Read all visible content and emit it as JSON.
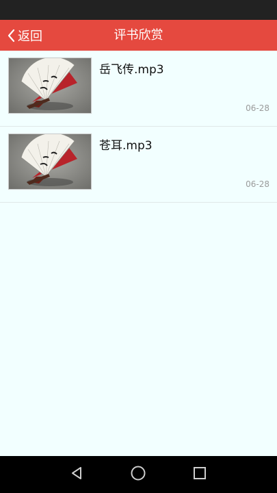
{
  "header": {
    "back_label": "返回",
    "title": "评书欣赏"
  },
  "items": [
    {
      "title": "岳飞传.mp3",
      "date": "06-28",
      "thumbnail": "folding-fan-image"
    },
    {
      "title": "苍耳.mp3",
      "date": "06-28",
      "thumbnail": "folding-fan-image"
    }
  ],
  "nav": {
    "back_icon": "triangle-back-icon",
    "home_icon": "circle-home-icon",
    "recents_icon": "square-recents-icon"
  },
  "colors": {
    "accent": "#e5493f",
    "background": "#f2ffff",
    "status_bar": "#222222",
    "nav_bar": "#000000"
  }
}
